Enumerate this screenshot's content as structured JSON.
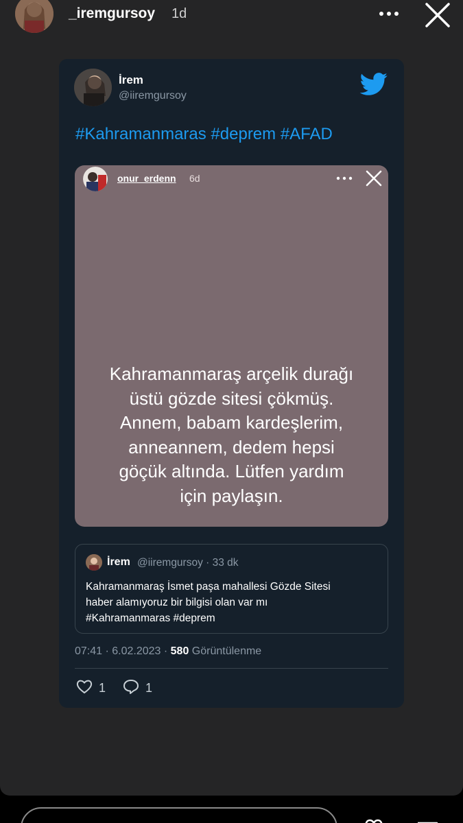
{
  "story": {
    "username": "_iremgursoy",
    "time": "1d",
    "more_icon": "ellipsis-icon",
    "close_icon": "close-icon"
  },
  "tweet": {
    "name": "İrem",
    "handle": "@iiremgursoy",
    "brand_icon": "twitter-bird-icon",
    "hashtags": "#Kahramanmaras #deprem #AFAD",
    "embedded_story": {
      "username": "onur_erdenn",
      "time": "6d",
      "text_lines": [
        "Kahramanmaraş arçelik durağı",
        "üstü gözde sitesi çökmüş.",
        "Annem, babam kardeşlerim,",
        "anneannem, dedem hepsi",
        "göçük altında. Lütfen yardım",
        "için paylaşın."
      ],
      "background_color": "#7b6a6f"
    },
    "quote": {
      "name": "İrem",
      "meta": "@iiremgursoy · 33 dk",
      "text_lines": [
        "Kahramanmaraş İsmet paşa mahallesi Gözde Sitesi",
        "haber alamıyoruz bir bilgisi olan var mı",
        "#Kahramanmaras #deprem"
      ]
    },
    "timestamp": "07:41 · 6.02.2023 · ",
    "views_count": "580",
    "views_label": " Görüntülenme",
    "likes": "1",
    "replies": "1",
    "colors": {
      "card_bg": "#15202b",
      "link": "#1d9bf0",
      "muted": "#8b98a5"
    }
  }
}
